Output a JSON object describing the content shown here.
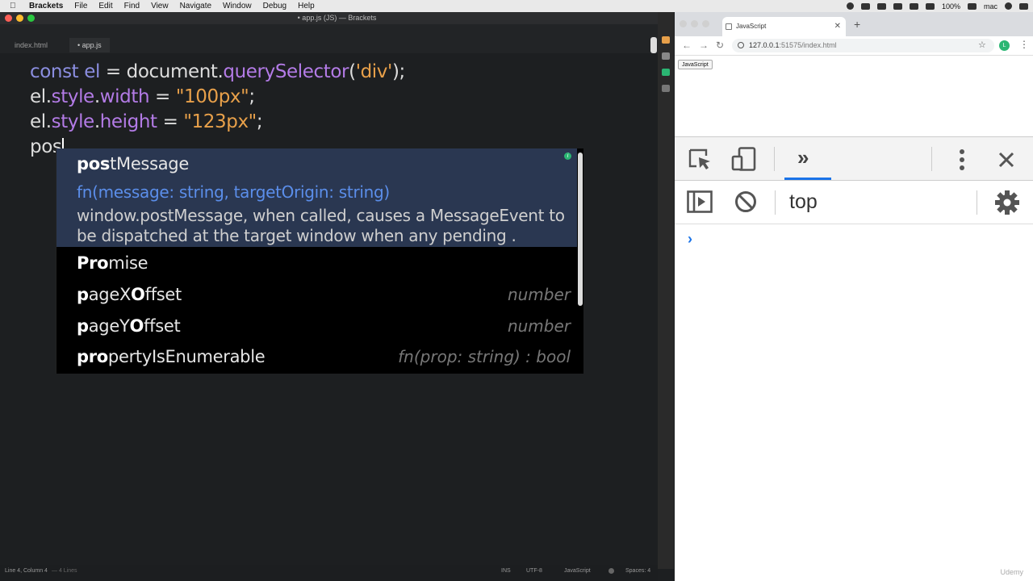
{
  "menubar": {
    "app_name": "Brackets",
    "items": [
      "File",
      "Edit",
      "Find",
      "View",
      "Navigate",
      "Window",
      "Debug",
      "Help"
    ],
    "battery": "100%",
    "user": "mac"
  },
  "window": {
    "title": "• app.js (JS) — Brackets"
  },
  "tabs": [
    {
      "label": "index.html"
    },
    {
      "label": "• app.js"
    }
  ],
  "editor": {
    "lines": [
      {
        "a": "const ",
        "b": "el",
        "c": " = document.",
        "d": "querySelector",
        "e": "(",
        "f": "'div'",
        "g": ");"
      },
      {
        "a": "el.",
        "b": "style",
        "c": ".",
        "d": "width",
        "e": " = ",
        "f": "\"100px\"",
        "g": ";"
      },
      {
        "a": "el.",
        "b": "style",
        "c": ".",
        "d": "height",
        "e": " = ",
        "f": "\"123px\"",
        "g": ";"
      },
      {
        "a": "pos"
      }
    ]
  },
  "hints": {
    "selected": {
      "match": "pos",
      "rest": "tMessage",
      "signature": "fn(message: string, targetOrigin: string)",
      "doc": "window.postMessage, when called, causes a MessageEvent to be dispatched at the target window when any pending ."
    },
    "items": [
      {
        "match": "Pro",
        "rest": "mise",
        "type": ""
      },
      {
        "match": "p",
        "rest_a": "ageX",
        "match_b": "O",
        "rest_b": "ffset",
        "type": "number"
      },
      {
        "match": "p",
        "rest_a": "ageY",
        "match_b": "O",
        "rest_b": "ffset",
        "type": "number"
      },
      {
        "match": "pro",
        "rest": "pertyIsEnumerable",
        "type": "fn(prop: string) : bool"
      }
    ]
  },
  "statusbar": {
    "position": "Line 4, Column 4",
    "lines": "— 4 Lines",
    "mode": "INS",
    "encoding": "UTF-8",
    "language": "JavaScript",
    "spaces": "Spaces: 4"
  },
  "chrome": {
    "tab_title": "JavaScript",
    "url_host": "127.0.0.1",
    "url_rest": ":51575/index.html",
    "avatar_letter": "L",
    "page_button": "JavaScript"
  },
  "devtools": {
    "context": "top"
  },
  "watermark": "Udemy",
  "colors": {
    "editor_bg": "#1d1f21",
    "keyword": "#8b8ee0",
    "property": "#b37be6",
    "string": "#e8a04a",
    "hint_selected_bg": "#2a3751",
    "signature": "#5b8eea",
    "devtools_accent": "#1a73e8"
  }
}
